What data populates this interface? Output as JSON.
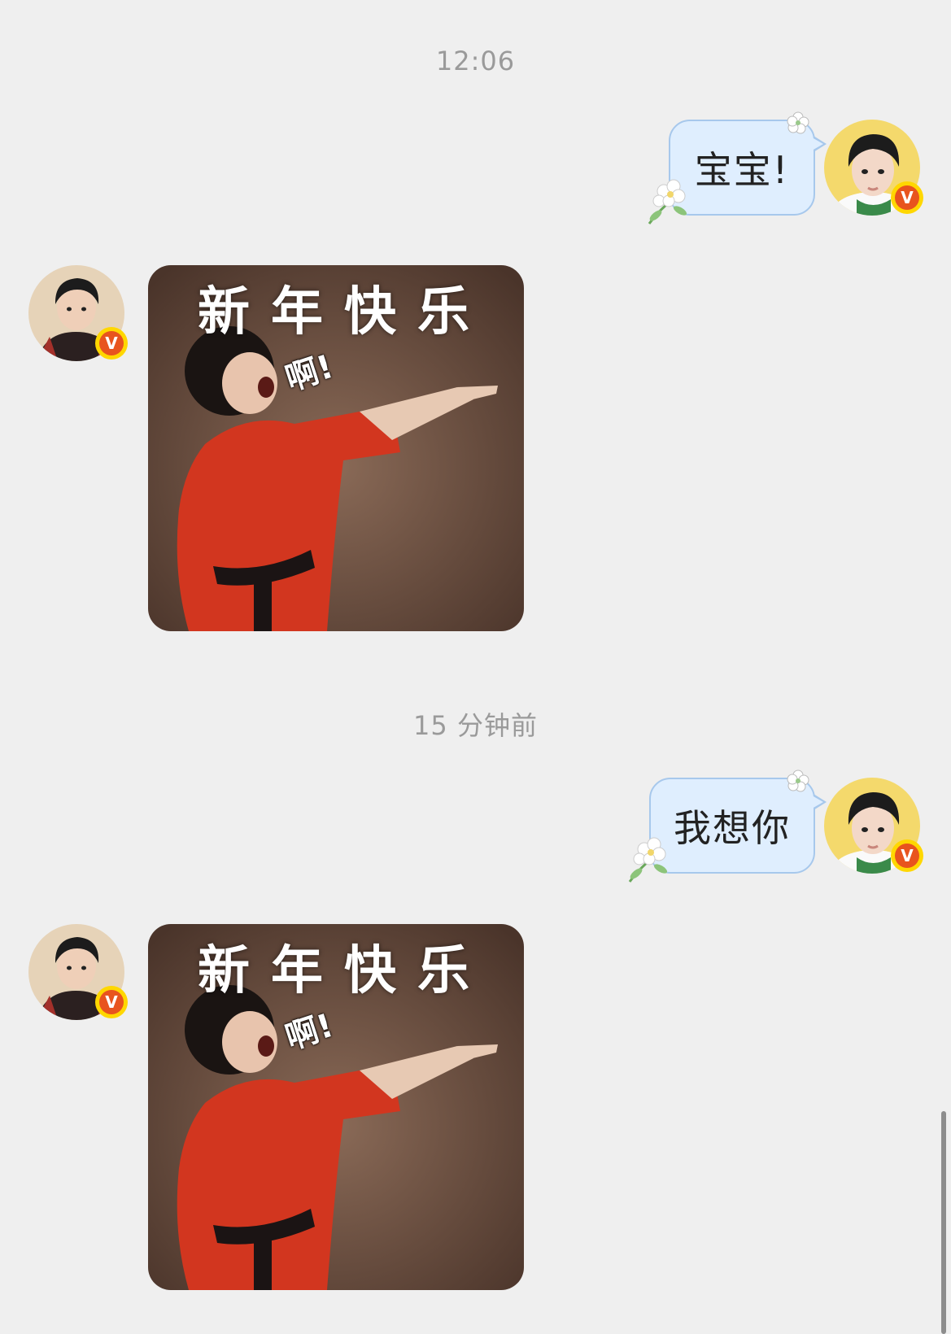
{
  "chat": {
    "messages": [
      {
        "type": "timestamp",
        "text": "12:06"
      },
      {
        "type": "outgoing_text",
        "text": "宝宝!",
        "avatar_icon": "user-avatar-self",
        "badge": "V"
      },
      {
        "type": "incoming_sticker",
        "sticker_caption": "新年快乐",
        "sticker_exclaim": "啊!",
        "avatar_icon": "user-avatar-other",
        "badge": "V"
      },
      {
        "type": "timestamp",
        "text": "15 分钟前"
      },
      {
        "type": "outgoing_text",
        "text": "我想你",
        "avatar_icon": "user-avatar-self",
        "badge": "V"
      },
      {
        "type": "incoming_sticker",
        "sticker_caption": "新年快乐",
        "sticker_exclaim": "啊!",
        "avatar_icon": "user-avatar-other",
        "badge": "V"
      }
    ]
  },
  "colors": {
    "background": "#efefef",
    "bubble_fill": "#dfeefe",
    "bubble_border": "#a7c8ec",
    "timestamp": "#9a9a9a",
    "badge": "#e8541e"
  }
}
